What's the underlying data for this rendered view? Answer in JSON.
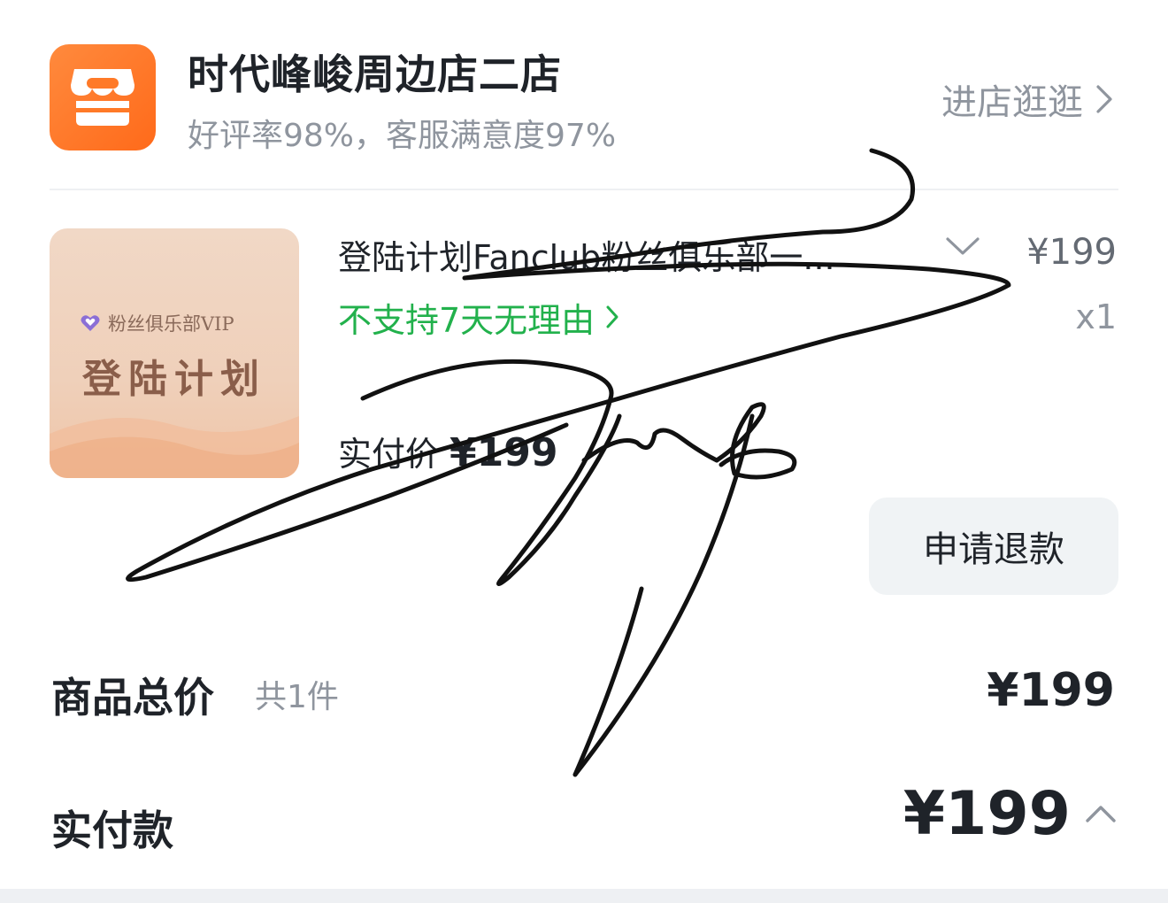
{
  "shop": {
    "name": "时代峰峻周边店二店",
    "rating": "好评率98%，客服满意度97%",
    "visit_label": "进店逛逛",
    "logo_icon": "store-icon",
    "accent_color": "#ff6a1a"
  },
  "item": {
    "thumbnail": {
      "tag": "粉丝俱乐部VIP",
      "title": "登陆计划"
    },
    "title": "登陆计划Fanclub粉丝俱乐部一...",
    "price": "¥199",
    "quantity": "x1",
    "return_policy": "不支持7天无理由",
    "return_policy_color": "#22b14c",
    "paid_label": "实付价",
    "paid_value": "¥199",
    "refund_label": "申请退款"
  },
  "summary": {
    "total_label": "商品总价",
    "total_count": "共1件",
    "total_value": "¥199",
    "actual_label": "实付款",
    "actual_value": "¥199"
  }
}
